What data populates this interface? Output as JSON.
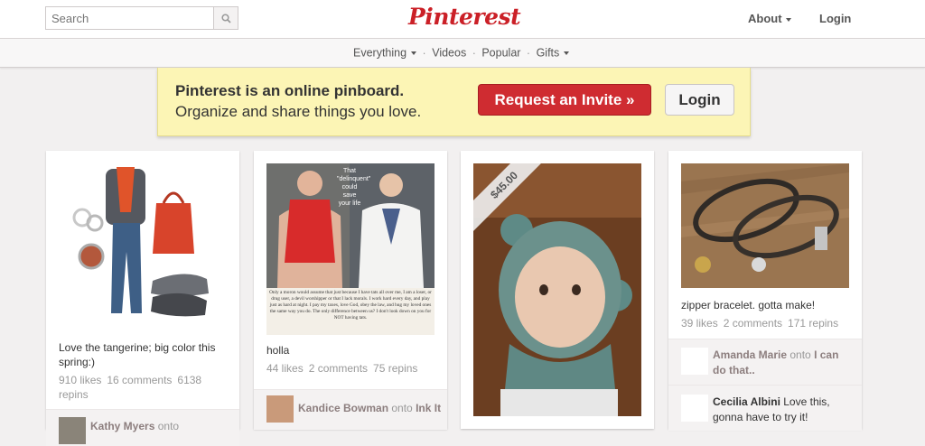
{
  "header": {
    "search_placeholder": "Search",
    "logo": "Pinterest",
    "about_label": "About",
    "login_label": "Login"
  },
  "subnav": {
    "items": [
      "Everything",
      "Videos",
      "Popular",
      "Gifts"
    ]
  },
  "banner": {
    "line1": "Pinterest is an online pinboard.",
    "line2": "Organize and share things you love.",
    "invite_label": "Request an Invite »",
    "login_label": "Login"
  },
  "pins": [
    {
      "description": "Love the tangerine; big color this spring:)",
      "likes": "910 likes",
      "comments": "16 comments",
      "repins": "6138 repins",
      "attribution": {
        "user": "Kathy Myers",
        "onto": "onto"
      }
    },
    {
      "image_caption": "That \"delinquent\" could save your life",
      "image_text": "Only a moron would assume that just because I have tats all over me, I am a loser, or drug user, a devil worshipper or that I lack morals. I work hard every day, and play just as hard at night. I pay my taxes, love God, obey the law, and hug my loved ones the same way you do. The only difference between us? I don't look down on you for NOT having tats.",
      "description": "holla",
      "likes": "44 likes",
      "comments": "2 comments",
      "repins": "75 repins",
      "attribution": {
        "user": "Kandice Bowman",
        "onto": "onto",
        "board": "Ink It"
      }
    },
    {
      "price": "$45.00"
    },
    {
      "description": "zipper bracelet. gotta make!",
      "likes": "39 likes",
      "comments": "2 comments",
      "repins": "171 repins",
      "comments_list": [
        {
          "user": "Amanda Marie",
          "onto": "onto",
          "text": "I can do that.."
        },
        {
          "user": "Cecilia Albini",
          "text": "Love this, gonna have to try it!"
        }
      ]
    }
  ],
  "colors": {
    "brand": "#cb2027",
    "invite_button": "#cf2c31",
    "banner_bg": "#fcf5b5",
    "page_bg": "#f2f0f0"
  }
}
